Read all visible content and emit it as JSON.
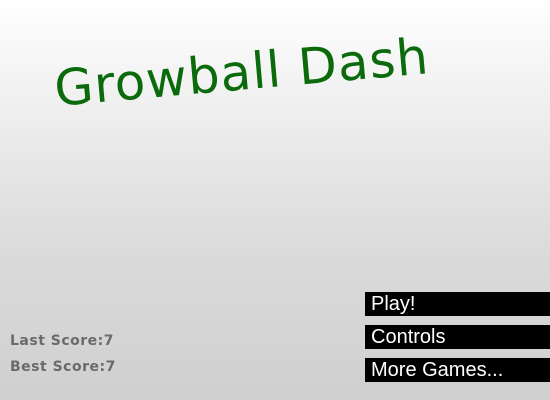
{
  "title": "Growball Dash",
  "menu": {
    "play_label": "Play!",
    "controls_label": "Controls",
    "more_games_label": "More Games..."
  },
  "scores": {
    "last_label": "Last Score:",
    "last_value": "7",
    "best_label": "Best Score:",
    "best_value": "7"
  },
  "colors": {
    "title": "#0b6a0b",
    "button_bg": "#000000",
    "button_text": "#ffffff",
    "score_text": "#6a6a6a"
  }
}
